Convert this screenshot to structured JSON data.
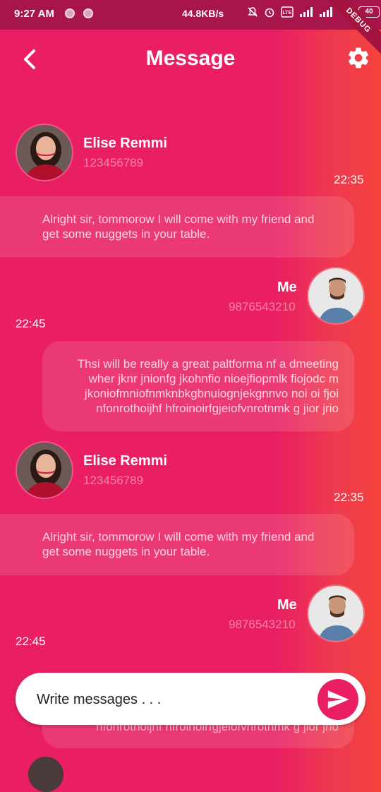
{
  "status_bar": {
    "time": "9:27 AM",
    "network_speed": "44.8KB/s",
    "battery": "40",
    "debug_label": "DEBUG"
  },
  "app_bar": {
    "title": "Message"
  },
  "messages": [
    {
      "sender": "Elise Remmi",
      "phone": "123456789",
      "time": "22:35",
      "text": "Alright sir, tommorow I will come with my friend and get some nuggets in your table."
    },
    {
      "sender": "Me",
      "phone": "9876543210",
      "time": "22:45",
      "text": "Thsi will be really a great paltforma nf a dmeeting wher  jknr jnionfg jkohnfio nioejfiopmlk fiojodc m jkoniofmniofnmknbkgbnuiognjekgnnvo noi oi fjoi nfonrothoijhf hfroinoirfgjeiofvnrotnmk g jior jrio"
    },
    {
      "sender": "Elise Remmi",
      "phone": "123456789",
      "time": "22:35",
      "text": "Alright sir, tommorow I will come with my friend and get some nuggets in your table."
    },
    {
      "sender": "Me",
      "phone": "9876543210",
      "time": "22:45",
      "text": "nfonrothoijhf hfroinoirfgjeiofvnrotnmk g jior jrio"
    }
  ],
  "composer": {
    "placeholder": "Write messages . . ."
  },
  "colors": {
    "primary": "#e91e63",
    "accent": "#f4433c"
  }
}
